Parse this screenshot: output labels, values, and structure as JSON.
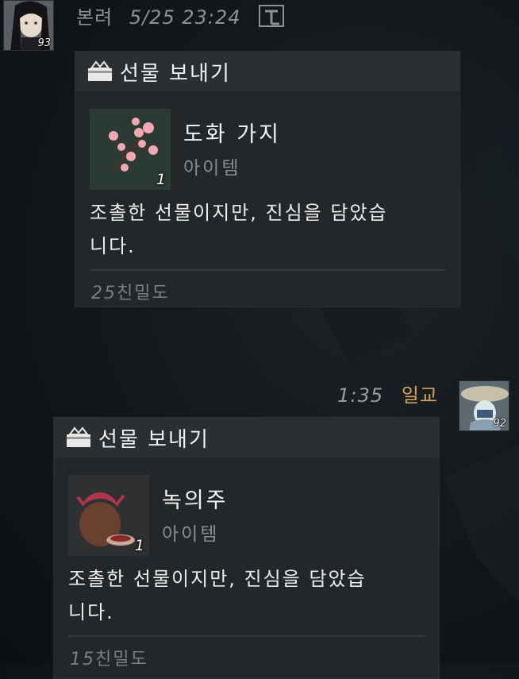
{
  "messages": [
    {
      "sender": "본려",
      "time": "5/25 23:24",
      "level": "93",
      "card": {
        "title": "선물 보내기",
        "item_name": "도화 가지",
        "item_type": "아이템",
        "quantity": "1",
        "description": "조촐한 선물이지만, 진심을 담았습니다.",
        "desc_line1": "조촐한 선물이지만, 진심을 담았습",
        "desc_line2": "니다.",
        "affinity_value": "25",
        "affinity_label": "친밀도"
      }
    },
    {
      "sender": "일교",
      "time": "1:35",
      "level": "92",
      "card": {
        "title": "선물 보내기",
        "item_name": "녹의주",
        "item_type": "아이템",
        "quantity": "1",
        "desc_line1": "조촐한 선물이지만, 진심을 담았습",
        "desc_line2": "니다.",
        "affinity_value": "15",
        "affinity_label": "친밀도"
      }
    }
  ],
  "icons": {
    "translate": "translate-icon",
    "gift": "gift-box-icon"
  },
  "colors": {
    "my_name": "#d5a35e",
    "card_bg": "#232729",
    "card_header_bg": "#2b2f32"
  }
}
